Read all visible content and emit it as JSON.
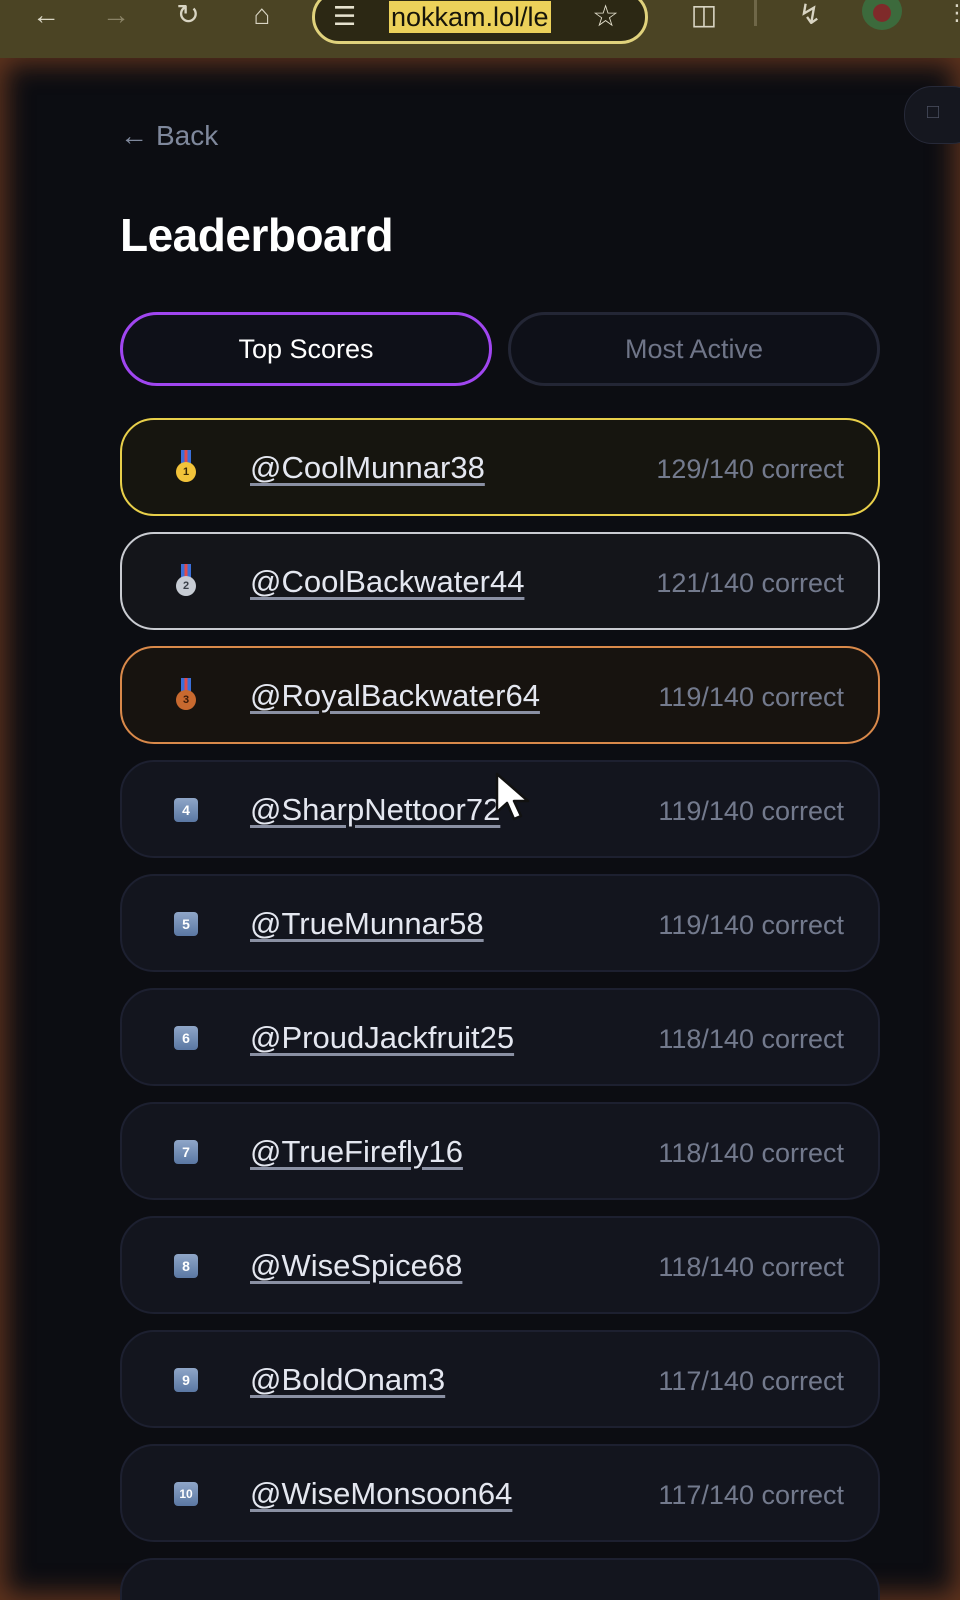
{
  "browser": {
    "url": "nokkam.lol/le",
    "icons": {
      "back": "arrow-left-icon",
      "forward": "arrow-right-icon",
      "reload": "reload-icon",
      "home": "home-icon",
      "site_info": "tune-icon",
      "bookmark": "star-icon",
      "extensions": "puzzle-icon",
      "performance": "lightning-icon",
      "profile": "avatar",
      "menu": "more-vertical-icon"
    }
  },
  "page": {
    "back_label": "Back",
    "title": "Leaderboard",
    "tabs": [
      {
        "label": "Top Scores",
        "active": true
      },
      {
        "label": "Most Active",
        "active": false
      }
    ],
    "entries": [
      {
        "rank": "1",
        "tier": "gold",
        "handle": "@CoolMunnar38",
        "score": "129/140 correct"
      },
      {
        "rank": "2",
        "tier": "silver",
        "handle": "@CoolBackwater44",
        "score": "121/140 correct"
      },
      {
        "rank": "3",
        "tier": "bronze",
        "handle": "@RoyalBackwater64",
        "score": "119/140 correct"
      },
      {
        "rank": "4",
        "tier": "plain",
        "handle": "@SharpNettoor72",
        "score": "119/140 correct"
      },
      {
        "rank": "5",
        "tier": "plain",
        "handle": "@TrueMunnar58",
        "score": "119/140 correct"
      },
      {
        "rank": "6",
        "tier": "plain",
        "handle": "@ProudJackfruit25",
        "score": "118/140 correct"
      },
      {
        "rank": "7",
        "tier": "plain",
        "handle": "@TrueFirefly16",
        "score": "118/140 correct"
      },
      {
        "rank": "8",
        "tier": "plain",
        "handle": "@WiseSpice68",
        "score": "118/140 correct"
      },
      {
        "rank": "9",
        "tier": "plain",
        "handle": "@BoldOnam3",
        "score": "117/140 correct"
      },
      {
        "rank": "10",
        "tier": "plain",
        "handle": "@WiseMonsoon64",
        "score": "117/140 correct"
      }
    ]
  },
  "colors": {
    "accent": "#a046f0",
    "gold": "#e8cf4a",
    "silver": "#c9cbd1",
    "bronze": "#d9894a"
  }
}
